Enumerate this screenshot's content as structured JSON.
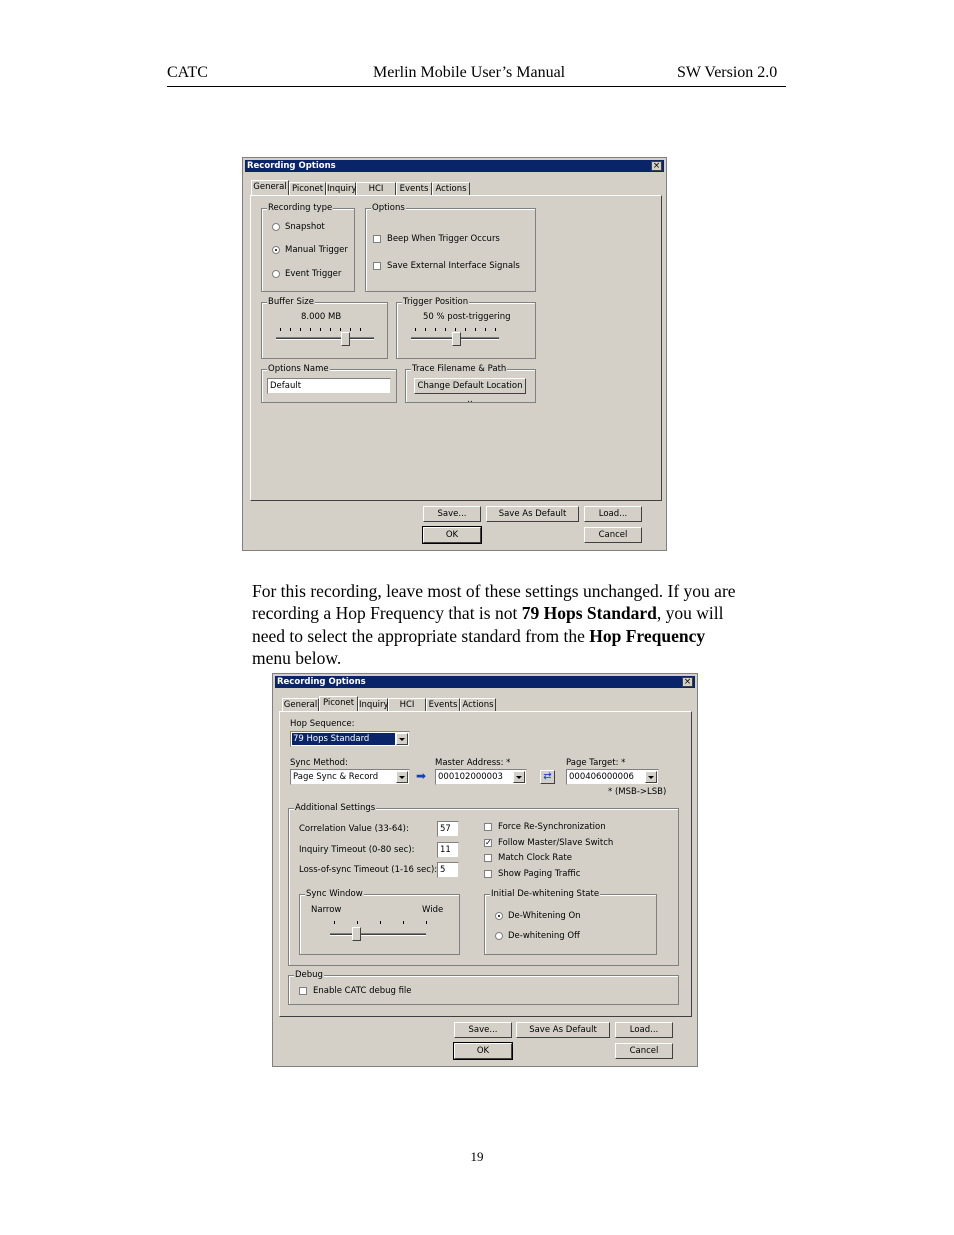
{
  "header": {
    "left": "CATC",
    "center": "Merlin Mobile User’s Manual",
    "right": "SW Version 2.0"
  },
  "dialog1": {
    "title": "Recording Options",
    "tabs": [
      "General",
      "Piconet",
      "Inquiry",
      "HCI",
      "Events",
      "Actions"
    ],
    "selected_tab": "General",
    "recording_type": {
      "label": "Recording type",
      "options": [
        "Snapshot",
        "Manual Trigger",
        "Event Trigger"
      ],
      "selected": "Manual Trigger"
    },
    "options_group": {
      "label": "Options",
      "items": [
        "Beep When Trigger Occurs",
        "Save External Interface Signals"
      ]
    },
    "buffer_size": {
      "label": "Buffer Size",
      "value": "8.000 MB"
    },
    "trigger_position": {
      "label": "Trigger Position",
      "value": "50 % post-triggering"
    },
    "options_name": {
      "label": "Options Name",
      "value": "Default"
    },
    "trace_filename": {
      "label": "Trace Filename & Path",
      "button": "Change Default Location .."
    },
    "buttons": {
      "save": "Save...",
      "save_default": "Save As Default",
      "load": "Load...",
      "ok": "OK",
      "cancel": "Cancel"
    }
  },
  "paragraph": {
    "t1": "For this recording, leave most of these settings unchanged.  If you are recording a Hop Frequency that is not ",
    "b1": "79 Hops Standard",
    "t2": ", you will need to select the appropriate standard from the ",
    "b2": "Hop Frequency",
    "t3": " menu below."
  },
  "dialog2": {
    "title": "Recording Options",
    "tabs": [
      "General",
      "Piconet",
      "Inquiry",
      "HCI",
      "Events",
      "Actions"
    ],
    "selected_tab": "Piconet",
    "hop_sequence": {
      "label": "Hop Sequence:",
      "value": "79 Hops Standard"
    },
    "sync_method": {
      "label": "Sync Method:",
      "value": "Page Sync & Record"
    },
    "master_address": {
      "label": "Master Address: *",
      "value": "000102000003"
    },
    "page_target": {
      "label": "Page Target: *",
      "value": "000406000006"
    },
    "msb_note": "* (MSB->LSB)",
    "additional": {
      "label": "Additional Settings",
      "correlation": {
        "label": "Correlation Value (33-64):",
        "value": "57"
      },
      "inquiry_timeout": {
        "label": "Inquiry Timeout (0-80 sec):",
        "value": "11"
      },
      "loss_timeout": {
        "label": "Loss-of-sync Timeout (1-16 sec):",
        "value": "5"
      },
      "checks": [
        {
          "label": "Force Re-Synchronization",
          "checked": false
        },
        {
          "label": "Follow Master/Slave Switch",
          "checked": true
        },
        {
          "label": "Match Clock Rate",
          "checked": false
        },
        {
          "label": "Show Paging Traffic",
          "checked": false
        }
      ],
      "sync_window": {
        "label": "Sync Window",
        "narrow": "Narrow",
        "wide": "Wide"
      },
      "dewhitening": {
        "label": "Initial De-whitening State",
        "options": [
          "De-Whitening On",
          "De-whitening Off"
        ],
        "selected": "De-Whitening On"
      }
    },
    "debug": {
      "label": "Debug",
      "item": "Enable CATC debug file",
      "checked": false
    },
    "buttons": {
      "save": "Save...",
      "save_default": "Save As Default",
      "load": "Load...",
      "ok": "OK",
      "cancel": "Cancel"
    }
  },
  "page_number": "19"
}
